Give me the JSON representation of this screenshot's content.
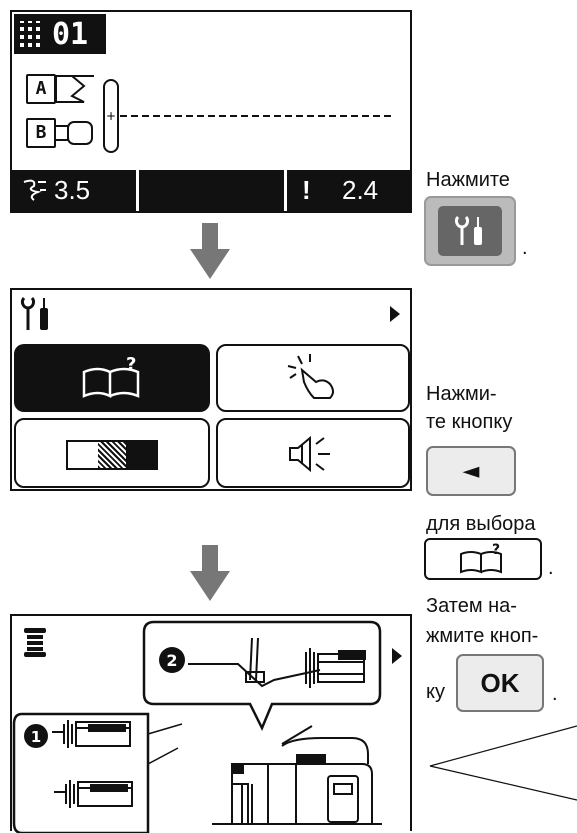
{
  "screen1": {
    "pattern_number": "01",
    "tag_a": "A",
    "tag_b": "B",
    "tension_value": "3.5",
    "warning_mark": "!",
    "stitch_length": "2.4"
  },
  "screen3": {
    "icon": "spool-icon"
  },
  "instructions": {
    "step1": "Нажмите",
    "step1_suffix": ".",
    "step2_line1": "Нажми-",
    "step2_line2": "те кнопку",
    "left_arrow": "◄",
    "step2_line3": "для выбора",
    "step2_suffix": ".",
    "step3_line1": "Затем на-",
    "step3_line2": "жмите кноп-",
    "step3_prefix": "ку",
    "ok_label": "OK",
    "step3_suffix": "."
  },
  "colors": {
    "arrow": "#777777",
    "lcd_fg": "#111111",
    "button_bg": "#ececec"
  }
}
